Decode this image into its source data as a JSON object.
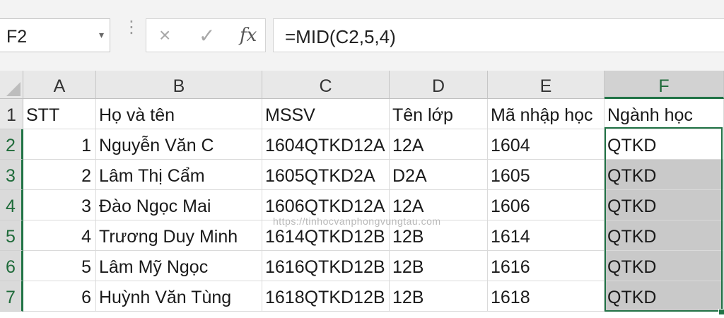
{
  "formula_bar": {
    "name_box": "F2",
    "name_box_arrow": "▾",
    "separator": "⋮",
    "cancel_icon": "×",
    "enter_icon": "✓",
    "fx_icon": "fx",
    "formula": "=MID(C2,5,4)"
  },
  "sheet": {
    "column_headers": [
      "A",
      "B",
      "C",
      "D",
      "E",
      "F"
    ],
    "selected_column": "F",
    "row_headers": [
      "1",
      "2",
      "3",
      "4",
      "5",
      "6",
      "7"
    ],
    "rows": [
      [
        "STT",
        "Họ và tên",
        "MSSV",
        "Tên lớp",
        "Mã nhập học",
        "Ngành học"
      ],
      [
        "1",
        "Nguyễn Văn C",
        "1604QTKD12A",
        "12A",
        "1604",
        "QTKD"
      ],
      [
        "2",
        "Lâm Thị Cẩm",
        "1605QTKD2A",
        "D2A",
        "1605",
        "QTKD"
      ],
      [
        "3",
        "Đào Ngọc Mai",
        "1606QTKD12A",
        "12A",
        "1606",
        "QTKD"
      ],
      [
        "4",
        "Trương Duy Minh",
        "1614QTKD12B",
        "12B",
        "1614",
        "QTKD"
      ],
      [
        "5",
        "Lâm Mỹ Ngọc",
        "1616QTKD12B",
        "12B",
        "1616",
        "QTKD"
      ],
      [
        "6",
        "Huỳnh Văn Tùng",
        "1618QTKD12B",
        "12B",
        "1618",
        "QTKD"
      ]
    ],
    "active_cell": "F2",
    "selection_range": "F2:F7"
  },
  "watermark": "https://tinhocvanphongvungtau.com",
  "colors": {
    "selection_green": "#217346",
    "selection_shade": "#c9c9c9",
    "header_bg": "#e8e8e8"
  }
}
